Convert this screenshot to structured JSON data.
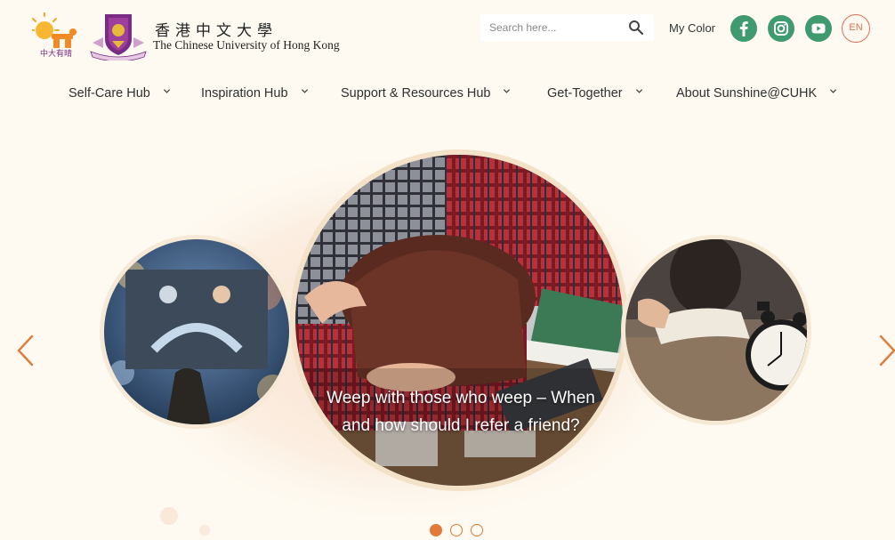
{
  "header": {
    "logo_small_text": "中大有晴",
    "university_zh": "香港中文大學",
    "university_en": "The Chinese University of Hong Kong",
    "search_placeholder": "Search here...",
    "my_color_label": "My Color",
    "language_label": "EN",
    "social_icons": [
      "facebook-icon",
      "instagram-icon",
      "youtube-icon"
    ],
    "social_color": "#3f9a6f"
  },
  "nav": {
    "items": [
      {
        "label": "Self-Care Hub"
      },
      {
        "label": "Inspiration Hub"
      },
      {
        "label": "Support & Resources Hub"
      },
      {
        "label": "Get-Together"
      },
      {
        "label": "About Sunshine@CUHK"
      }
    ]
  },
  "carousel": {
    "caption": "Weep with those who weep – When and how should I refer a friend?",
    "slide_count": 3,
    "active_index": 0,
    "accent_color": "#e07b39",
    "prev_icon": "chevron-left-icon",
    "next_icon": "chevron-right-icon"
  }
}
